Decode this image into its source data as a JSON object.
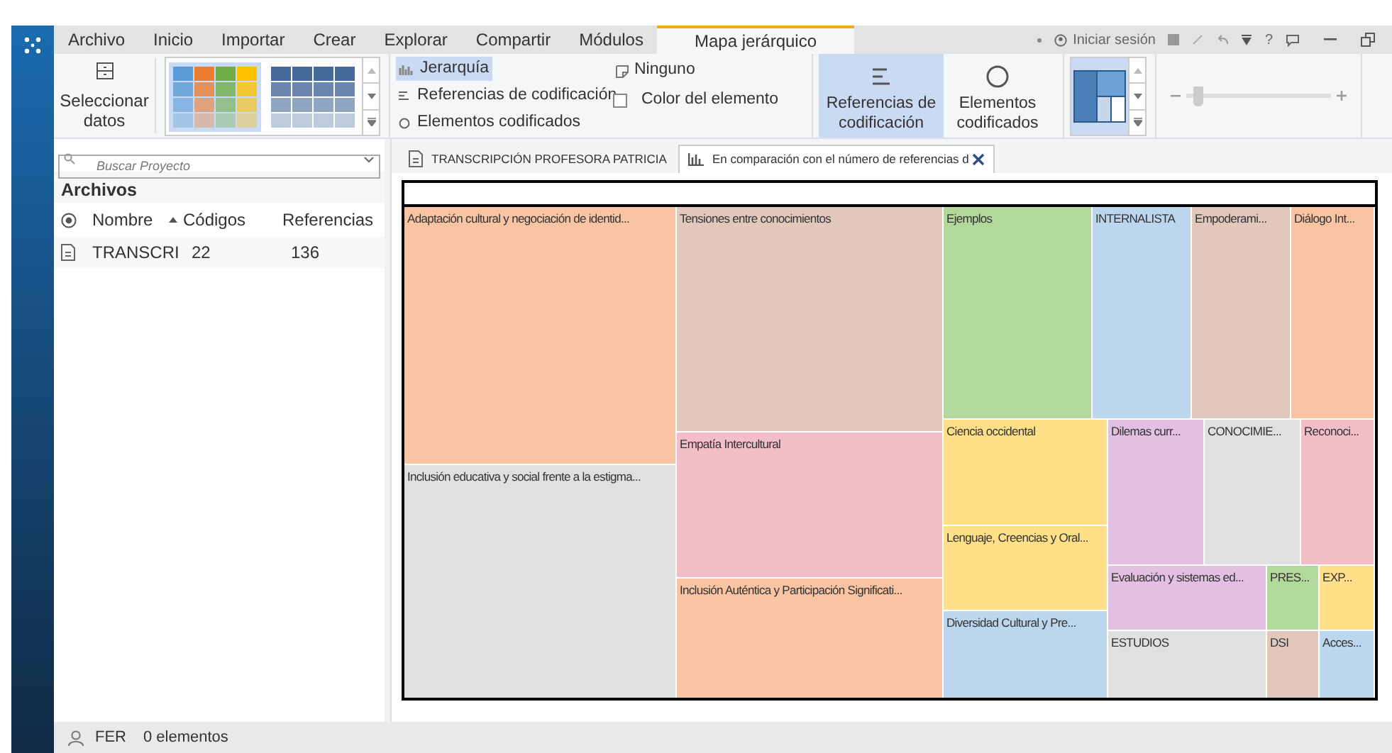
{
  "ribbon_tabs": [
    {
      "label": "Archivo",
      "selected": false
    },
    {
      "label": "Inicio",
      "selected": false
    },
    {
      "label": "Importar",
      "selected": false
    },
    {
      "label": "Crear",
      "selected": false
    },
    {
      "label": "Explorar",
      "selected": false
    },
    {
      "label": "Compartir",
      "selected": false
    },
    {
      "label": "Módulos",
      "selected": false
    },
    {
      "label": "Mapa jerárquico",
      "selected": true
    }
  ],
  "title_bar": {
    "sign_in": "Iniciar sesión",
    "help": "?"
  },
  "ribbon": {
    "select_data": "Seleccionar datos",
    "style_gallery": [
      {
        "selected": true
      },
      {
        "selected": false
      }
    ],
    "display_options": [
      {
        "label": "Jerarquía",
        "selected": true
      },
      {
        "label": "Referencias de codificación",
        "selected": false
      },
      {
        "label": "Elementos codificados",
        "selected": false
      }
    ],
    "color_options": [
      {
        "label": "Ninguno",
        "kind": "option",
        "selected": false
      },
      {
        "label": "Color del elemento",
        "kind": "checkbox",
        "checked": false
      }
    ],
    "size_buttons": [
      {
        "label": "Referencias de codificación",
        "selected": true
      },
      {
        "label": "Elementos codificados",
        "selected": false
      }
    ],
    "zoom": {
      "level": 0.05
    }
  },
  "project": {
    "search_placeholder": "Buscar Proyecto",
    "title": "Archivos",
    "columns": [
      "Nombre",
      "Códigos",
      "Referencias"
    ],
    "rows": [
      {
        "name": "TRANSCRI",
        "codes": "22",
        "references": "136"
      }
    ]
  },
  "doc_tabs": [
    {
      "label": "TRANSCRIPCIÓN PROFESORA PATRICIA",
      "kind": "document",
      "selected": false
    },
    {
      "label": "En comparación con el número de referencias d",
      "kind": "chart",
      "selected": true
    }
  ],
  "treemap": [
    {
      "label": "Adaptación cultural y negociación de identid...",
      "color": "#f8c4a3"
    },
    {
      "label": "Inclusión educativa y social frente a la estigma...",
      "color": "#e0e0e0"
    },
    {
      "label": "Tensiones entre conocimientos",
      "color": "#e2c8bc"
    },
    {
      "label": "Empatía Intercultural",
      "color": "#f3bec7"
    },
    {
      "label": "Inclusión Auténtica y Participación Significati...",
      "color": "#f8c4a3"
    },
    {
      "label": "Ejemplos",
      "color": "#b3d89b"
    },
    {
      "label": "INTERNALISTA",
      "color": "#bcd6ee"
    },
    {
      "label": "Empoderami...",
      "color": "#e2c8bc"
    },
    {
      "label": "Diálogo Int...",
      "color": "#f8c4a3"
    },
    {
      "label": "Ciencia occidental",
      "color": "#ffdf88"
    },
    {
      "label": "Lenguaje, Creencias y Oral...",
      "color": "#ffdf88"
    },
    {
      "label": "Diversidad Cultural y Pre...",
      "color": "#bcd6ee"
    },
    {
      "label": "Dilemas curr...",
      "color": "#e3c0e2"
    },
    {
      "label": "CONOCIMIE...",
      "color": "#e0e0e0"
    },
    {
      "label": "Reconoci...",
      "color": "#f3bec7"
    },
    {
      "label": "Evaluación y sistemas ed...",
      "color": "#e3c0e2"
    },
    {
      "label": "PRES...",
      "color": "#b3d89b"
    },
    {
      "label": "EXP...",
      "color": "#ffdf88"
    },
    {
      "label": "ESTUDIOS",
      "color": "#e0e0e0"
    },
    {
      "label": "DSI",
      "color": "#e2c8bc"
    },
    {
      "label": "Acces...",
      "color": "#bcd6ee"
    }
  ],
  "status_bar": {
    "user": "FER",
    "items": "0 elementos"
  }
}
